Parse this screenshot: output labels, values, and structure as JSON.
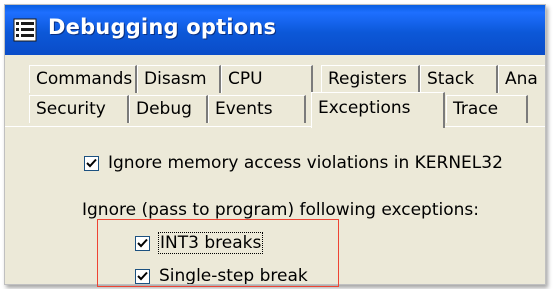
{
  "window": {
    "title": "Debugging options"
  },
  "tabs_row1": [
    {
      "label": "Commands"
    },
    {
      "label": "Disasm"
    },
    {
      "label": "CPU"
    },
    {
      "label": "Registers"
    },
    {
      "label": "Stack"
    },
    {
      "label": "Ana"
    }
  ],
  "tabs_row2": [
    {
      "label": "Security"
    },
    {
      "label": "Debug"
    },
    {
      "label": "Events"
    },
    {
      "label": "Exceptions",
      "active": true
    },
    {
      "label": "Trace"
    }
  ],
  "options": {
    "ignore_kernel32": {
      "label": "Ignore memory access violations in KERNEL32",
      "checked": true
    },
    "ignore_header": "Ignore (pass to program) following exceptions:",
    "int3": {
      "label": "INT3 breaks",
      "checked": true
    },
    "single_step": {
      "label": "Single-step break",
      "checked": true
    }
  },
  "colors": {
    "title_bar": "#0a5fe0",
    "highlight": "#ee4433",
    "face": "#ece9d8"
  }
}
